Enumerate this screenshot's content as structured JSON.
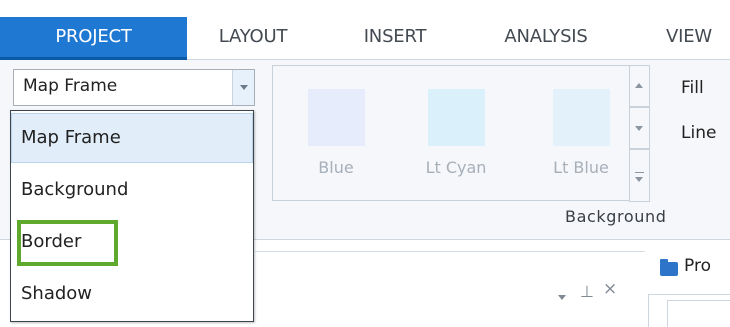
{
  "tabs": [
    {
      "label": "PROJECT",
      "active": true
    },
    {
      "label": "LAYOUT",
      "active": false
    },
    {
      "label": "INSERT",
      "active": false
    },
    {
      "label": "ANALYSIS",
      "active": false
    },
    {
      "label": "VIEW",
      "active": false
    }
  ],
  "combo": {
    "value": "Map Frame"
  },
  "dropdown": {
    "items": [
      {
        "label": "Map Frame",
        "selected": true
      },
      {
        "label": "Background",
        "selected": false
      },
      {
        "label": "Border",
        "selected": false,
        "highlighted": true
      },
      {
        "label": "Shadow",
        "selected": false
      }
    ]
  },
  "gallery": {
    "swatches": [
      {
        "label": "Blue",
        "color": "#e6ecfc"
      },
      {
        "label": "Lt Cyan",
        "color": "#daf1fb"
      },
      {
        "label": "Lt Blue",
        "color": "#e3f1fb"
      }
    ]
  },
  "ribbon": {
    "fill_label": "Fill",
    "line_label": "Line",
    "group_label": "Background"
  },
  "pane": {
    "title_fragment": "Pro"
  },
  "colors": {
    "accent": "#1f78d1",
    "highlight": "#5faa2d",
    "selected_bg": "#e1edf8"
  }
}
